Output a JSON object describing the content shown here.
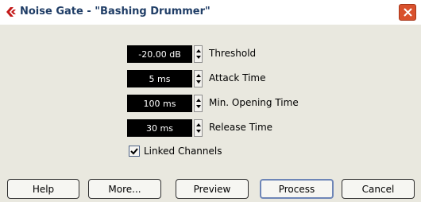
{
  "titlebar": {
    "title": "Noise Gate - \"Bashing Drummer\"",
    "icon": "cubase-logo-icon",
    "close_icon": "close-icon",
    "close_color": "#d9512d"
  },
  "parameters": [
    {
      "value": "-20.00 dB",
      "label": "Threshold"
    },
    {
      "value": "5 ms",
      "label": "Attack Time"
    },
    {
      "value": "100 ms",
      "label": "Min. Opening Time"
    },
    {
      "value": "30 ms",
      "label": "Release Time"
    }
  ],
  "linked": {
    "label": "Linked Channels",
    "checked": true
  },
  "buttons": [
    {
      "label": "Help"
    },
    {
      "label": "More..."
    },
    {
      "label": "Preview"
    },
    {
      "label": "Process",
      "focused": true
    },
    {
      "label": "Cancel"
    }
  ]
}
